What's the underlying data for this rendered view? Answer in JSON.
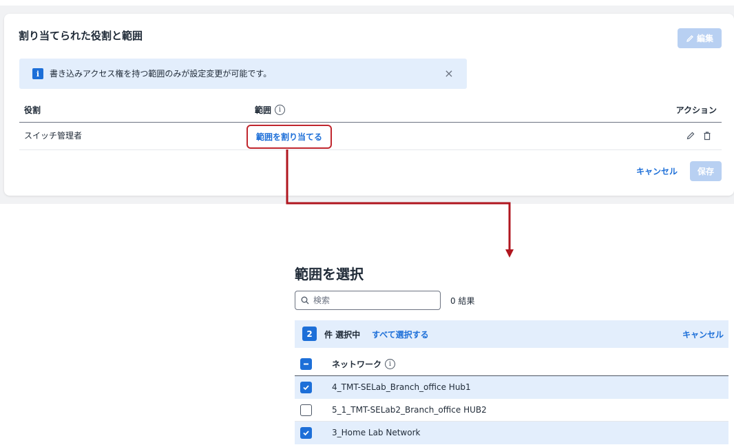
{
  "card": {
    "title": "割り当てられた役割と範囲",
    "edit_label": "編集",
    "banner_text": "書き込みアクセス権を持つ範囲のみが設定変更が可能です。",
    "banner_info_glyph": "i",
    "banner_close_glyph": "×",
    "columns": {
      "role": "役割",
      "scope": "範囲",
      "action": "アクション"
    },
    "row": {
      "role": "スイッチ管理者",
      "scope_link": "範囲を割り当てる"
    },
    "cancel_label": "キャンセル",
    "save_label": "保存"
  },
  "modal": {
    "title": "範囲を選択",
    "search_placeholder": "検索",
    "result_count": "0 結果",
    "selected_count": "2",
    "selected_label": "件 選択中",
    "select_all_label": "すべて選択する",
    "cancel_label": "キャンセル",
    "column_network": "ネットワーク",
    "networks": [
      {
        "name": "4_TMT-SELab_Branch_office Hub1",
        "checked": true
      },
      {
        "name": "5_1_TMT-SELab2_Branch_office HUB2",
        "checked": false
      },
      {
        "name": "3_Home Lab Network",
        "checked": true
      }
    ]
  },
  "colors": {
    "accent": "#1d6fd8",
    "highlight_border": "#c0262d",
    "connector": "#b0161f",
    "disabled_button": "#b8d0f2",
    "selected_row": "#e3eefc"
  },
  "icons": [
    "pencil-icon",
    "info-icon",
    "close-icon",
    "trash-icon",
    "search-icon",
    "checkbox-icon"
  ]
}
